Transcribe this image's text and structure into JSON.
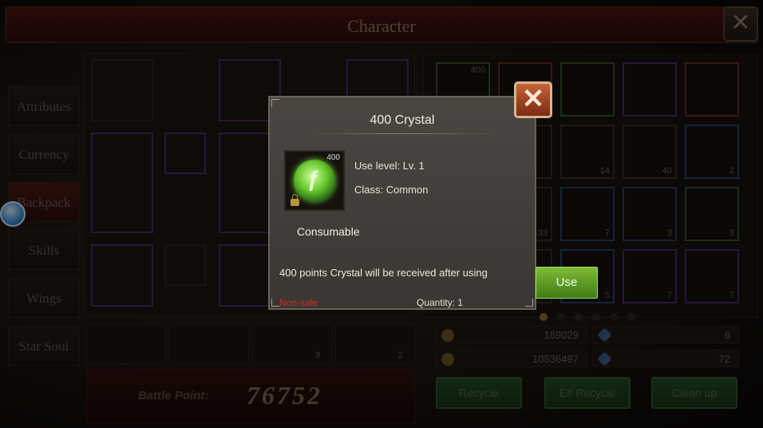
{
  "header": {
    "title": "Character"
  },
  "tabs": [
    "Attributes",
    "Currency",
    "Backpack",
    "Skills",
    "Wings",
    "Star Soul"
  ],
  "equipment": {
    "bottom_counts": [
      "",
      "",
      "3",
      "2"
    ]
  },
  "battle": {
    "label": "Battle Point:",
    "value": "76752"
  },
  "bag": {
    "counts": [
      "400",
      "",
      "",
      "",
      "",
      "",
      "",
      "14",
      "40",
      "2",
      "",
      "33",
      "7",
      "3",
      "3",
      "",
      "",
      "5",
      "7",
      "7"
    ]
  },
  "currency": {
    "gold": "169029",
    "diamond": "6",
    "bound_gold": "10536497",
    "bound_diamond": "72"
  },
  "actions": {
    "recycle": "Recycle",
    "elf_recycle": "Elf Recycle",
    "clean_up": "Clean up"
  },
  "modal": {
    "title": "400 Crystal",
    "icon_qty": "400",
    "use_level": "Use level: Lv. 1",
    "class": "Class: Common",
    "type": "Consumable",
    "description": "400 points Crystal will be received after using",
    "sale_status": "Non-sale",
    "quantity": "Quantity: 1",
    "use_label": "Use",
    "close_glyph": "✕"
  },
  "colors": {
    "nonsale": "#d12f23",
    "use_button": "#6aa82a"
  }
}
